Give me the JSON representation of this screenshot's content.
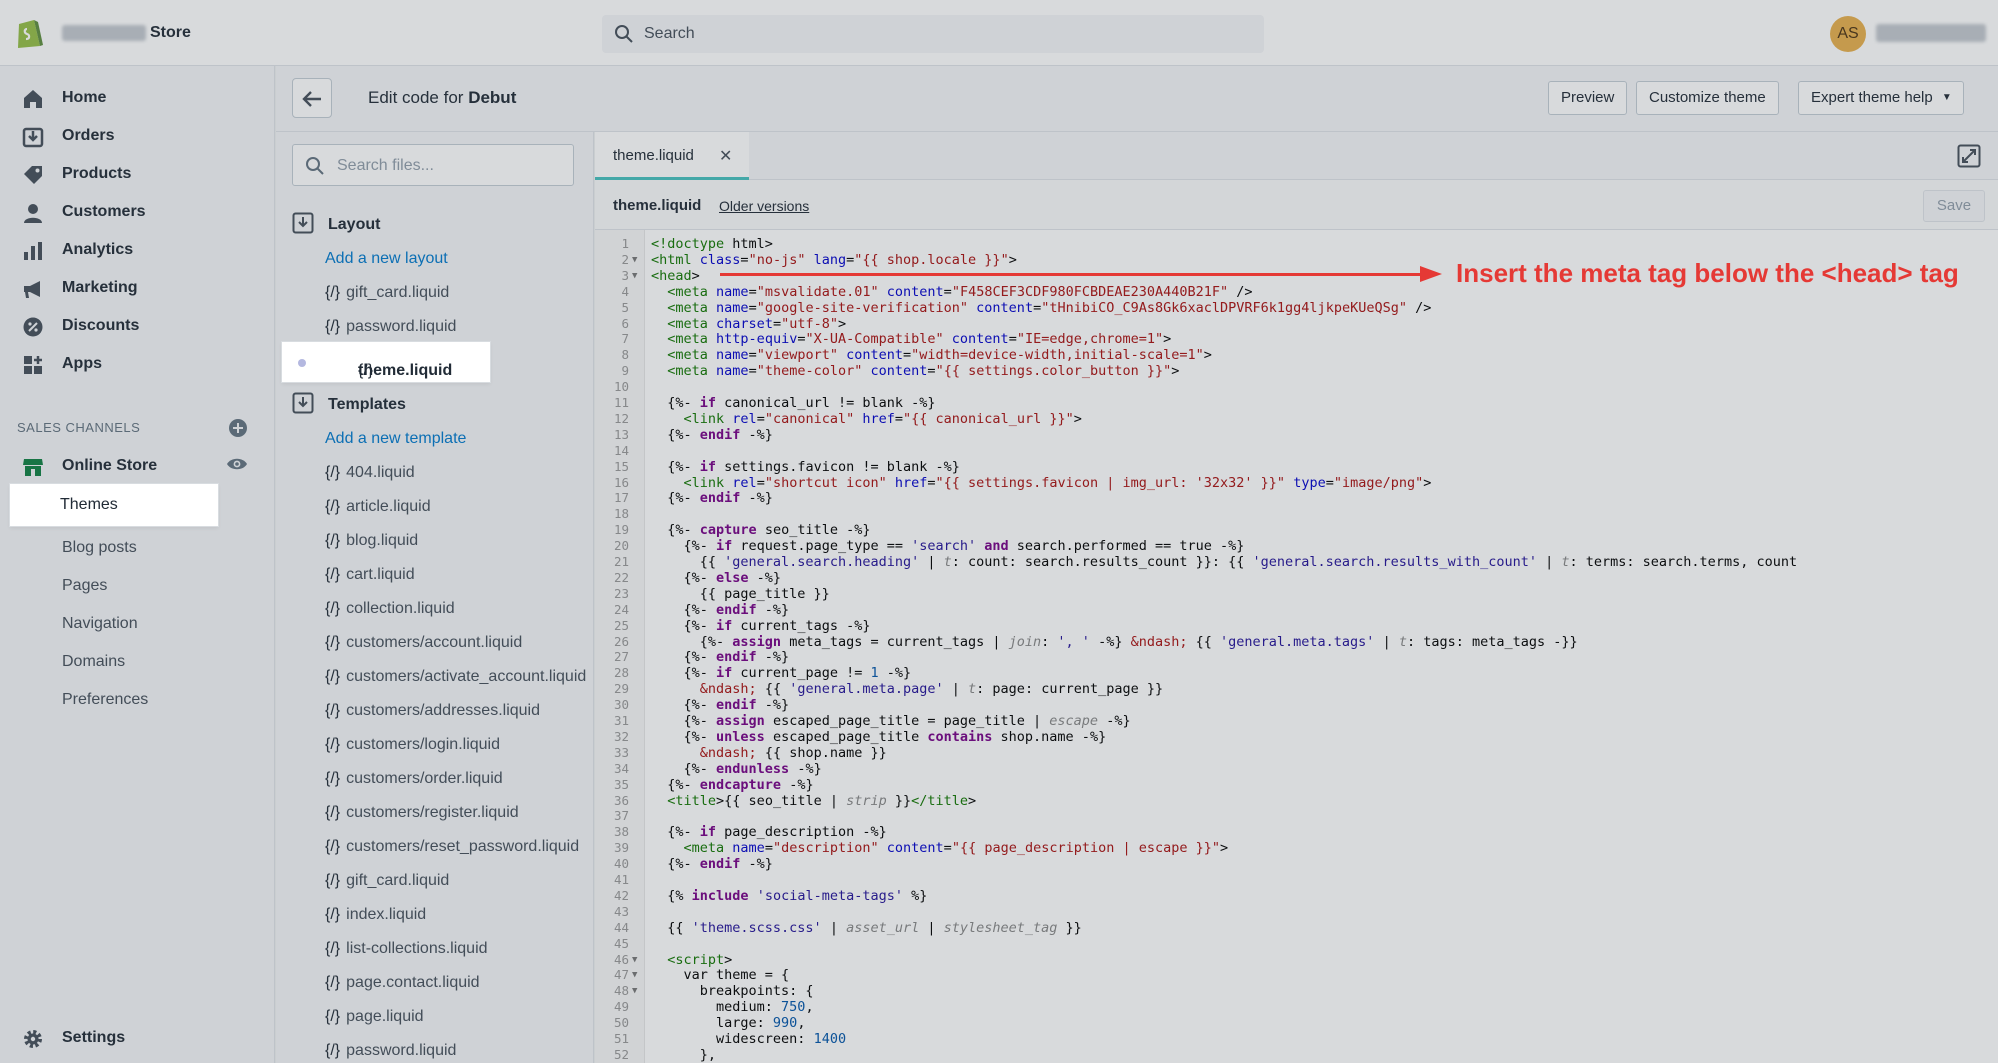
{
  "topbar": {
    "store_name": "Store",
    "search_placeholder": "Search",
    "avatar_initials": "AS"
  },
  "nav": {
    "items": [
      "Home",
      "Orders",
      "Products",
      "Customers",
      "Analytics",
      "Marketing",
      "Discounts",
      "Apps"
    ],
    "channels_label": "SALES CHANNELS",
    "online_store": "Online Store",
    "sub_items": [
      "Themes",
      "Blog posts",
      "Pages",
      "Navigation",
      "Domains",
      "Preferences"
    ],
    "settings": "Settings"
  },
  "header": {
    "title_prefix": "Edit code for",
    "theme_name": "Debut",
    "preview": "Preview",
    "customize": "Customize theme",
    "expert": "Expert theme help"
  },
  "files": {
    "search_placeholder": "Search files...",
    "layout_title": "Layout",
    "add_layout": "Add a new layout",
    "layout_files": [
      "gift_card.liquid",
      "password.liquid",
      "theme.liquid"
    ],
    "templates_title": "Templates",
    "add_template": "Add a new template",
    "template_files": [
      "404.liquid",
      "article.liquid",
      "blog.liquid",
      "cart.liquid",
      "collection.liquid",
      "customers/account.liquid",
      "customers/activate_account.liquid",
      "customers/addresses.liquid",
      "customers/login.liquid",
      "customers/order.liquid",
      "customers/register.liquid",
      "customers/reset_password.liquid",
      "gift_card.liquid",
      "index.liquid",
      "list-collections.liquid",
      "page.contact.liquid",
      "page.liquid",
      "password.liquid"
    ],
    "file_glyph": "{/}"
  },
  "editor": {
    "tab": "theme.liquid",
    "file_name": "theme.liquid",
    "older_versions": "Older versions",
    "save": "Save"
  },
  "code_lines": [
    "<!doctype html>",
    "<html class=\"no-js\" lang=\"{{ shop.locale }}\">",
    "<head>",
    "  <meta name=\"msvalidate.01\" content=\"F458CEF3CDF980FCBDEAE230A440B21F\" />",
    "  <meta name=\"google-site-verification\" content=\"tHnibiCO_C9As8Gk6xaclDPVRF6k1gg4ljkpeKUeQSg\" />",
    "  <meta charset=\"utf-8\">",
    "  <meta http-equiv=\"X-UA-Compatible\" content=\"IE=edge,chrome=1\">",
    "  <meta name=\"viewport\" content=\"width=device-width,initial-scale=1\">",
    "  <meta name=\"theme-color\" content=\"{{ settings.color_button }}\">",
    "",
    "  {%- if canonical_url != blank -%}",
    "    <link rel=\"canonical\" href=\"{{ canonical_url }}\">",
    "  {%- endif -%}",
    "",
    "  {%- if settings.favicon != blank -%}",
    "    <link rel=\"shortcut icon\" href=\"{{ settings.favicon | img_url: '32x32' }}\" type=\"image/png\">",
    "  {%- endif -%}",
    "",
    "  {%- capture seo_title -%}",
    "    {%- if request.page_type == 'search' and search.performed == true -%}",
    "      {{ 'general.search.heading' | t: count: search.results_count }}: {{ 'general.search.results_with_count' | t: terms: search.terms, count",
    "    {%- else -%}",
    "      {{ page_title }}",
    "    {%- endif -%}",
    "    {%- if current_tags -%}",
    "      {%- assign meta_tags = current_tags | join: ', ' -%} &ndash; {{ 'general.meta.tags' | t: tags: meta_tags -}}",
    "    {%- endif -%}",
    "    {%- if current_page != 1 -%}",
    "      &ndash; {{ 'general.meta.page' | t: page: current_page }}",
    "    {%- endif -%}",
    "    {%- assign escaped_page_title = page_title | escape -%}",
    "    {%- unless escaped_page_title contains shop.name -%}",
    "      &ndash; {{ shop.name }}",
    "    {%- endunless -%}",
    "  {%- endcapture -%}",
    "  <title>{{ seo_title | strip }}</title>",
    "",
    "  {%- if page_description -%}",
    "    <meta name=\"description\" content=\"{{ page_description | escape }}\">",
    "  {%- endif -%}",
    "",
    "  {% include 'social-meta-tags' %}",
    "",
    "  {{ 'theme.scss.css' | asset_url | stylesheet_tag }}",
    "",
    "  <script>",
    "    var theme = {",
    "      breakpoints: {",
    "        medium: 750,",
    "        large: 990,",
    "        widescreen: 1400",
    "      },"
  ],
  "annotation": {
    "text": "Insert the meta tag below the <head> tag",
    "color": "#e53935"
  }
}
